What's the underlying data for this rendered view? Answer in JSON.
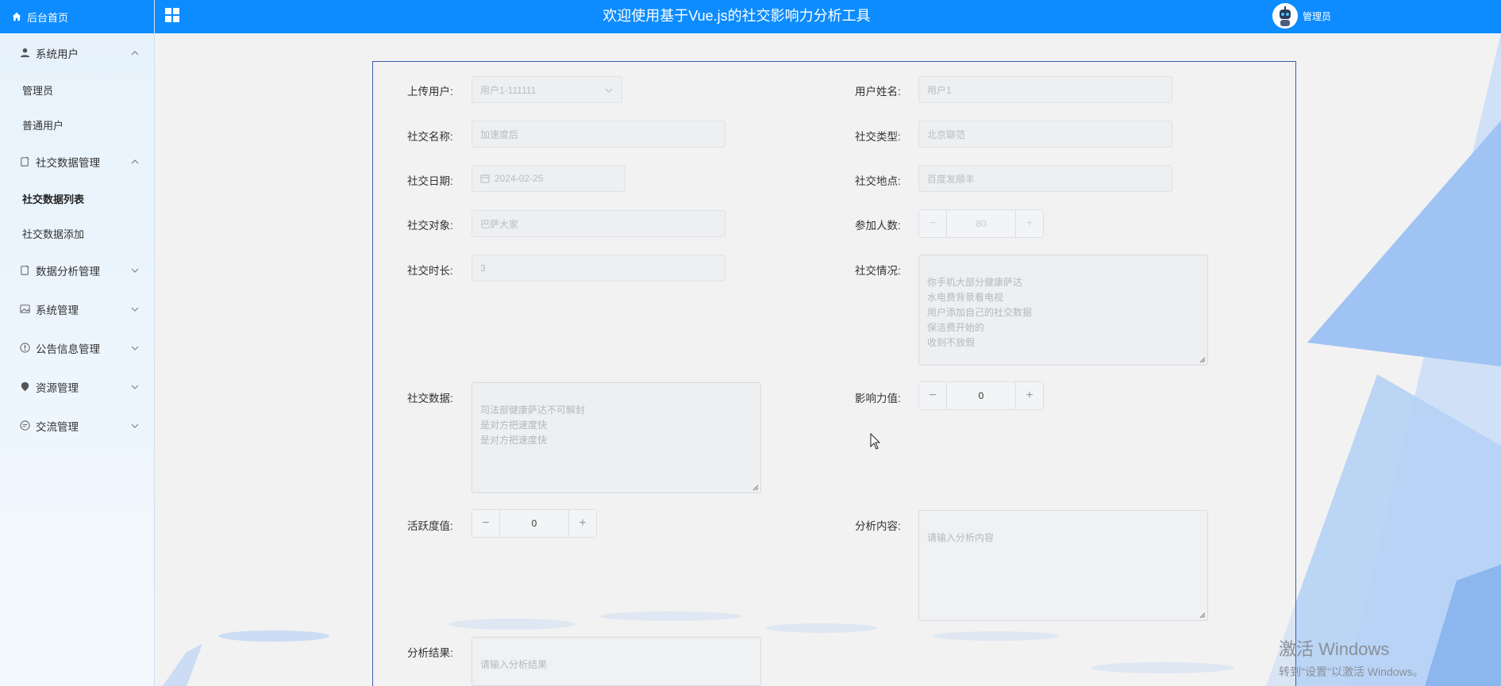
{
  "sidebar": {
    "home": "后台首页",
    "groups": [
      {
        "label": "系统用户",
        "items": [
          "管理员",
          "普通用户"
        ]
      },
      {
        "label": "社交数据管理",
        "items": [
          "社交数据列表",
          "社交数据添加"
        ]
      },
      {
        "label": "数据分析管理"
      },
      {
        "label": "系统管理"
      },
      {
        "label": "公告信息管理"
      },
      {
        "label": "资源管理"
      },
      {
        "label": "交流管理"
      }
    ]
  },
  "header": {
    "title": "欢迎使用基于Vue.js的社交影响力分析工具",
    "user": "管理员"
  },
  "form": {
    "upload_user_label": "上传用户:",
    "upload_user_value": "用户1-111111",
    "user_name_label": "用户姓名:",
    "user_name_value": "用户1",
    "social_name_label": "社交名称:",
    "social_name_value": "加速度后",
    "social_type_label": "社交类型:",
    "social_type_value": "北京聊范",
    "social_date_label": "社交日期:",
    "social_date_value": "2024-02-25",
    "social_place_label": "社交地点:",
    "social_place_value": "百度发顺丰",
    "social_target_label": "社交对象:",
    "social_target_value": "巴萨大家",
    "participants_label": "参加人数:",
    "participants_value": "80",
    "duration_label": "社交时长:",
    "duration_value": "3",
    "situation_label": "社交情况:",
    "situation_value": "你手机大部分健康萨达\n水电费背景看电视\n用户添加自己的社交数据\n保洁费开始的\n收到不放假",
    "social_data_label": "社交数据:",
    "social_data_value": "司法部健康萨达不可解封\n是对方把速度快\n是对方把速度快",
    "influence_label": "影响力值:",
    "influence_value": "0",
    "activity_label": "活跃度值:",
    "activity_value": "0",
    "analysis_content_label": "分析内容:",
    "analysis_content_placeholder": "请输入分析内容",
    "analysis_result_label": "分析结果:",
    "analysis_result_placeholder": "请输入分析结果"
  },
  "watermark": {
    "line1": "激活 Windows",
    "line2": "转到\"设置\"以激活 Windows。"
  },
  "colors": {
    "primary": "#0d8cff",
    "panel_border": "#3a5ca8"
  }
}
